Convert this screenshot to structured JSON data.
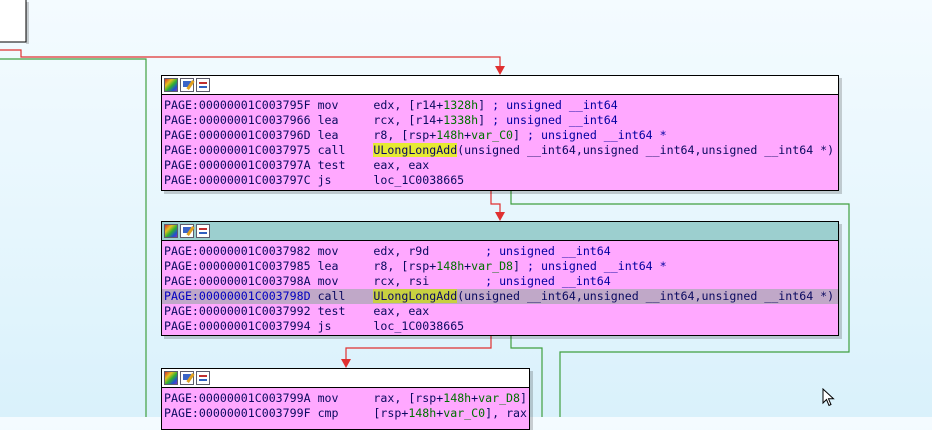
{
  "colors": {
    "node_fill": "#ffa8ff",
    "edge_red": "#e03030",
    "edge_green": "#40a040",
    "selected_line": "#c0a8c8",
    "active_header": "#9ccfcf",
    "function_highlight": "#e6ea33"
  },
  "header_icons": [
    "palette-icon",
    "rename-icon",
    "graph-icon"
  ],
  "blocks": [
    {
      "lines": [
        {
          "addr": "PAGE:00000001C003795F",
          "mn": "mov ",
          "ops": "edx, [r14+1328h] ; unsigned __int64"
        },
        {
          "addr": "PAGE:00000001C0037966",
          "mn": "lea ",
          "ops": "rcx, [r14+1338h] ; unsigned __int64"
        },
        {
          "addr": "PAGE:00000001C003796D",
          "mn": "lea ",
          "ops": "r8, [rsp+148h+var_C0] ; unsigned __int64 *"
        },
        {
          "addr": "PAGE:00000001C0037975",
          "mn": "call",
          "ops": "ULongLongAdd(unsigned __int64,unsigned __int64,unsigned __int64 *)"
        },
        {
          "addr": "PAGE:00000001C003797A",
          "mn": "test",
          "ops": "eax, eax"
        },
        {
          "addr": "PAGE:00000001C003797C",
          "mn": "js  ",
          "ops": "loc_1C0038665"
        }
      ]
    },
    {
      "lines": [
        {
          "addr": "PAGE:00000001C0037982",
          "mn": "mov ",
          "ops": "edx, r9d        ; unsigned __int64"
        },
        {
          "addr": "PAGE:00000001C0037985",
          "mn": "lea ",
          "ops": "r8, [rsp+148h+var_D8] ; unsigned __int64 *"
        },
        {
          "addr": "PAGE:00000001C003798A",
          "mn": "mov ",
          "ops": "rcx, rsi        ; unsigned __int64"
        },
        {
          "addr": "PAGE:00000001C003798D",
          "mn": "call",
          "ops": "ULongLongAdd(unsigned __int64,unsigned __int64,unsigned __int64 *)"
        },
        {
          "addr": "PAGE:00000001C0037992",
          "mn": "test",
          "ops": "eax, eax"
        },
        {
          "addr": "PAGE:00000001C0037994",
          "mn": "js  ",
          "ops": "loc_1C0038665"
        }
      ]
    },
    {
      "lines": [
        {
          "addr": "PAGE:00000001C003799A",
          "mn": "mov ",
          "ops": "rax, [rsp+148h+var_D8]"
        },
        {
          "addr": "PAGE:00000001C003799F",
          "mn": "cmp ",
          "ops": "[rsp+148h+var_C0], rax"
        }
      ]
    }
  ]
}
